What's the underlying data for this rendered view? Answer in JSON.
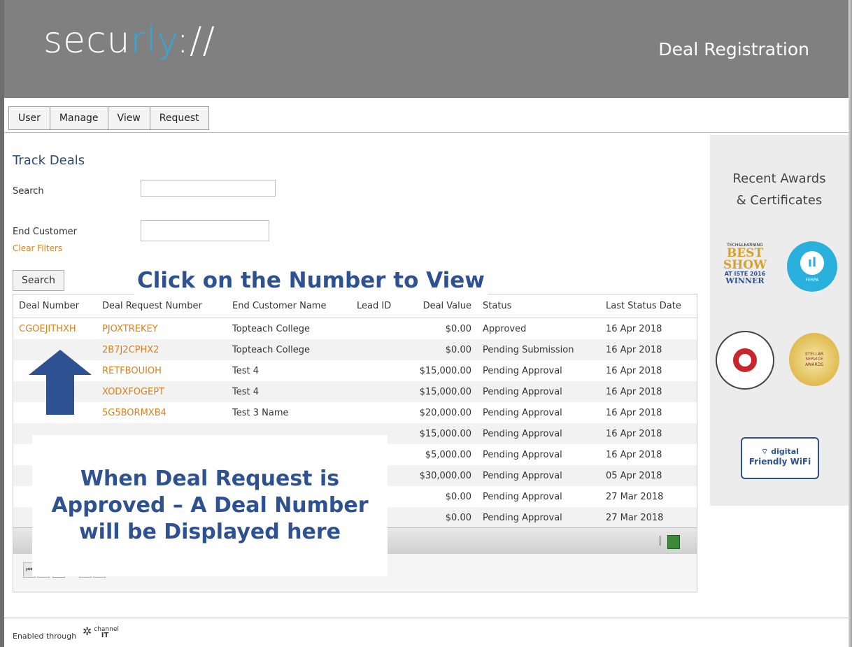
{
  "header": {
    "logo_main": "secu",
    "logo_accent": "rly",
    "logo_end": "://",
    "title": "Deal Registration"
  },
  "menu": [
    "User",
    "Manage",
    "View",
    "Request"
  ],
  "page": {
    "title": "Track Deals",
    "search_label": "Search",
    "end_customer_label": "End Customer",
    "clear_filters": "Clear Filters",
    "search_button": "Search"
  },
  "callouts": {
    "top": "Click on the Number to View",
    "box": "When Deal Request is Approved – A Deal Number will be Displayed here"
  },
  "table": {
    "headers": [
      "Deal Number",
      "Deal Request Number",
      "End Customer Name",
      "Lead ID",
      "Deal Value",
      "Status",
      "Last Status Date"
    ],
    "rows": [
      [
        "CGOEJITHXH",
        "PJOXTREKEY",
        "Topteach College",
        "",
        "$0.00",
        "Approved",
        "16 Apr 2018"
      ],
      [
        "",
        "2B7J2CPHX2",
        "Topteach College",
        "",
        "$0.00",
        "Pending Submission",
        "16 Apr 2018"
      ],
      [
        "",
        "RETFBOUIOH",
        "Test 4",
        "",
        "$15,000.00",
        "Pending Approval",
        "16 Apr 2018"
      ],
      [
        "",
        "XODXFOGEPT",
        "Test 4",
        "",
        "$15,000.00",
        "Pending Approval",
        "16 Apr 2018"
      ],
      [
        "",
        "5G5BORMXB4",
        "Test 3 Name",
        "",
        "$20,000.00",
        "Pending Approval",
        "16 Apr 2018"
      ],
      [
        "",
        "",
        "",
        "",
        "$15,000.00",
        "Pending Approval",
        "16 Apr 2018"
      ],
      [
        "",
        "",
        "",
        "",
        "$5,000.00",
        "Pending Approval",
        "16 Apr 2018"
      ],
      [
        "",
        "",
        "",
        "",
        "$30,000.00",
        "Pending Approval",
        "05 Apr 2018"
      ],
      [
        "",
        "",
        "",
        "",
        "$0.00",
        "Pending Approval",
        "27 Mar 2018"
      ],
      [
        "",
        "",
        "",
        "",
        "$0.00",
        "Pending Approval",
        "27 Mar 2018"
      ]
    ]
  },
  "pager": {
    "pages": [
      "1",
      "2"
    ],
    "separator": "|"
  },
  "sidebar": {
    "title": "Recent Awards\n& Certificates",
    "awards": [
      {
        "top": "TECH&LEARNING",
        "main": "BEST SHOW",
        "sub": "AT ISTE 2016",
        "foot": "WINNER"
      },
      {
        "label": "FERPA"
      },
      {
        "label": "INTERNET WATCH FOUNDATION"
      },
      {
        "label": "STELLAR SERVICE AWARDS"
      },
      {
        "line1": "digital",
        "line2": "Friendly WiFi"
      }
    ]
  },
  "footer": {
    "enabled": "Enabled through",
    "channel": "channel",
    "it": "IT"
  }
}
